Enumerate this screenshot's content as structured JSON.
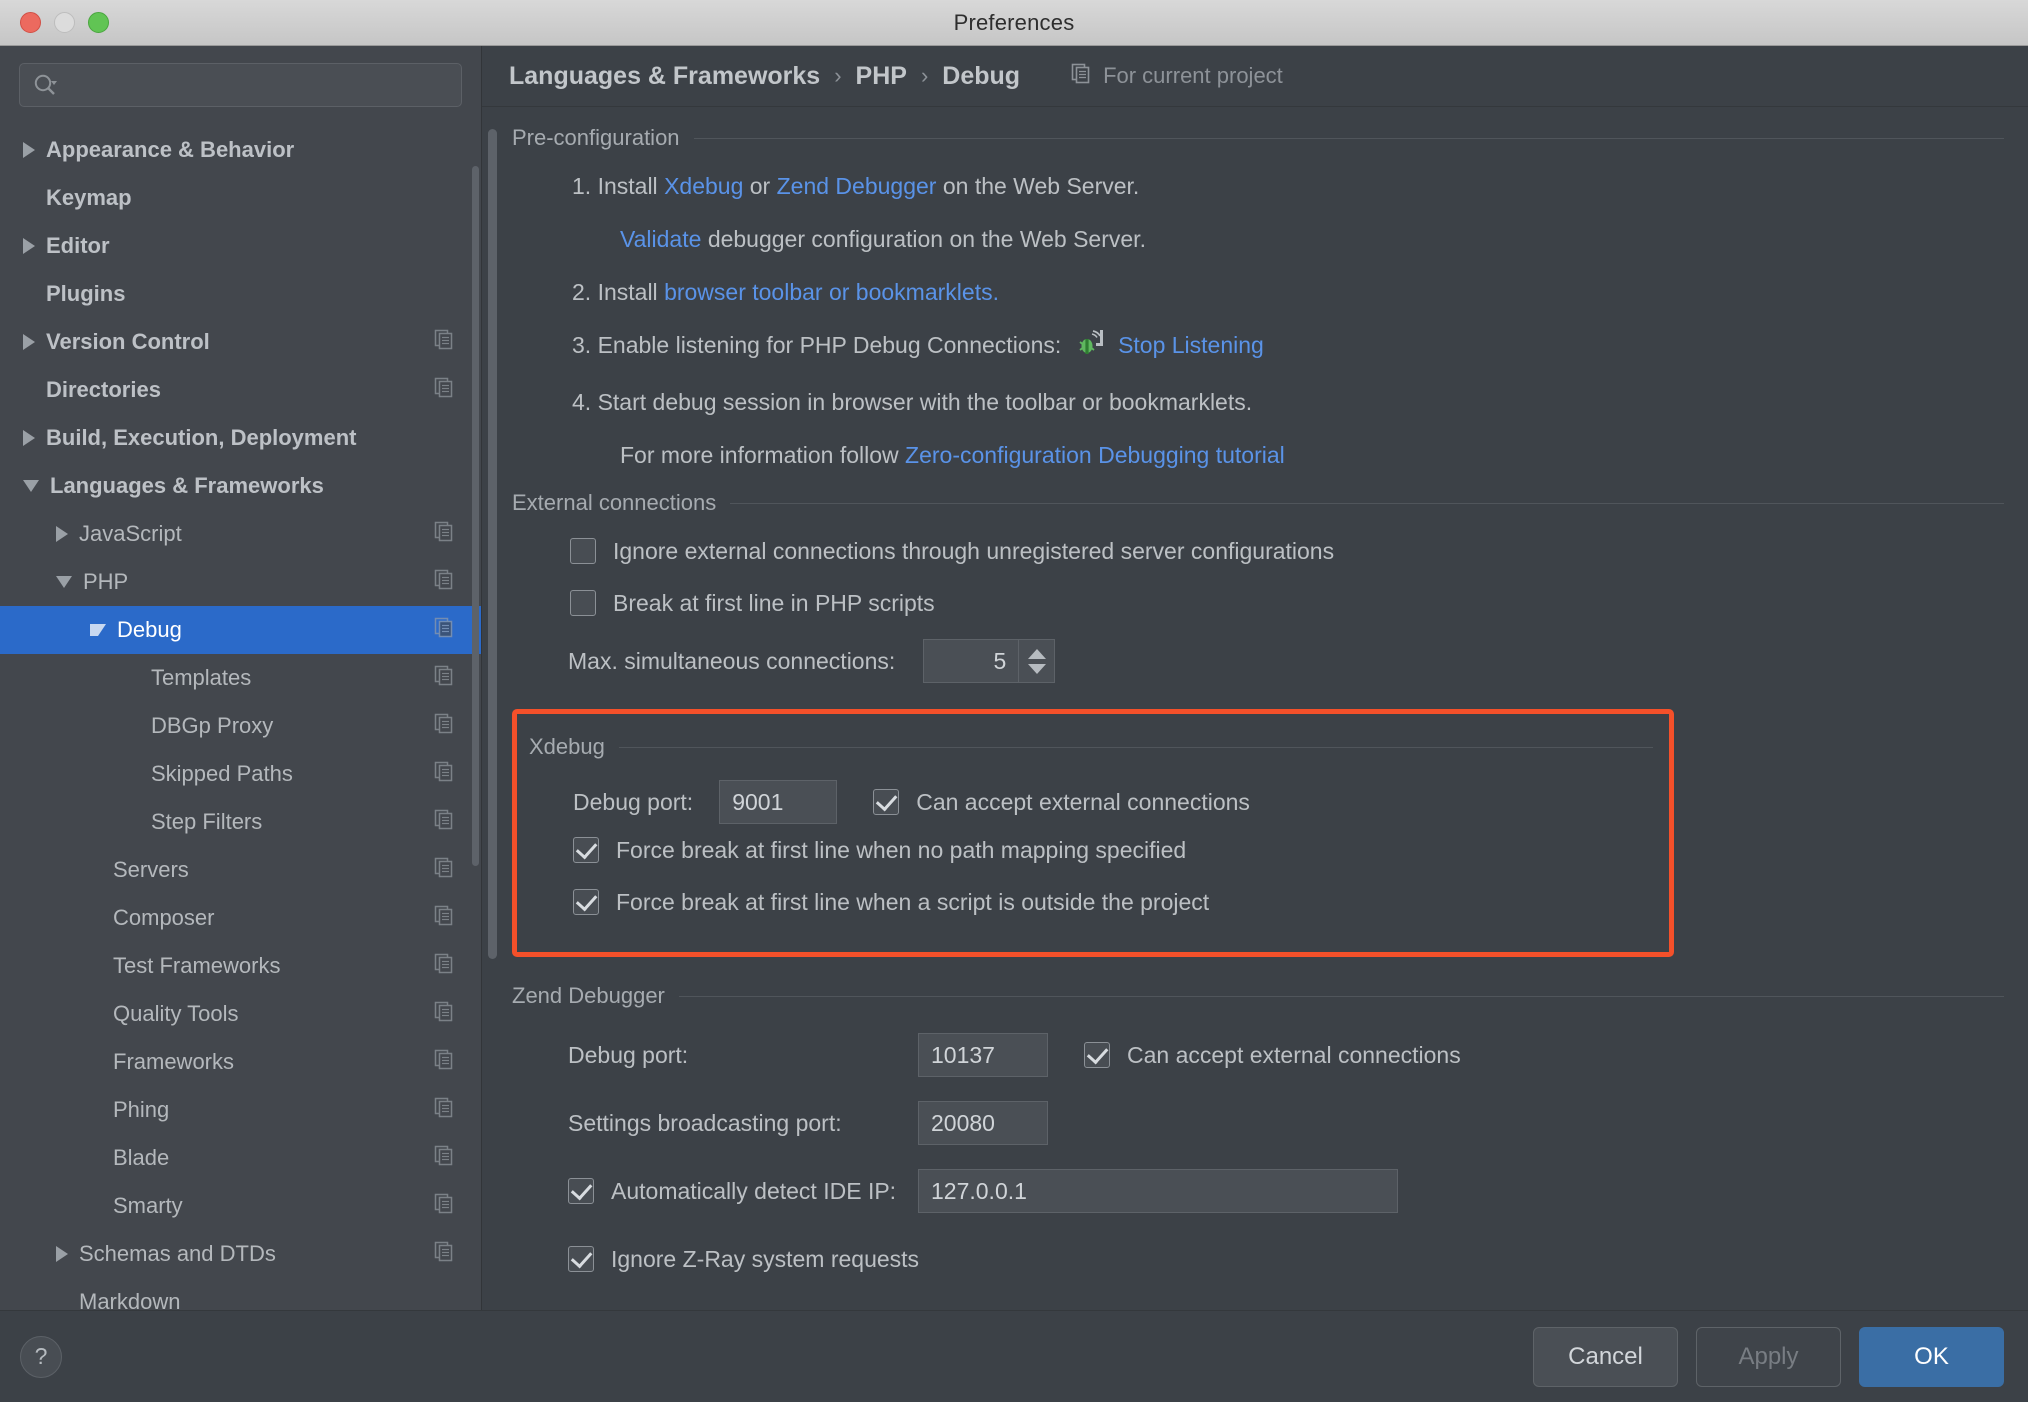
{
  "window": {
    "title": "Preferences",
    "traffic_lights": [
      "close-button",
      "minimize-button",
      "zoom-button"
    ]
  },
  "sidebar": {
    "search": {
      "placeholder": "",
      "value": "",
      "icon": "search-icon"
    },
    "items": [
      {
        "label": "Appearance & Behavior",
        "indent": 0,
        "arrow": "right",
        "bold": true,
        "badge": false,
        "selected": false
      },
      {
        "label": "Keymap",
        "indent": 0,
        "arrow": "none",
        "bold": true,
        "badge": false,
        "selected": false
      },
      {
        "label": "Editor",
        "indent": 0,
        "arrow": "right",
        "bold": true,
        "badge": false,
        "selected": false
      },
      {
        "label": "Plugins",
        "indent": 0,
        "arrow": "none",
        "bold": true,
        "badge": false,
        "selected": false
      },
      {
        "label": "Version Control",
        "indent": 0,
        "arrow": "right",
        "bold": true,
        "badge": true,
        "selected": false
      },
      {
        "label": "Directories",
        "indent": 0,
        "arrow": "none",
        "bold": true,
        "badge": true,
        "selected": false
      },
      {
        "label": "Build, Execution, Deployment",
        "indent": 0,
        "arrow": "right",
        "bold": true,
        "badge": false,
        "selected": false
      },
      {
        "label": "Languages & Frameworks",
        "indent": 0,
        "arrow": "down",
        "bold": true,
        "badge": false,
        "selected": false
      },
      {
        "label": "JavaScript",
        "indent": 1,
        "arrow": "right",
        "bold": false,
        "badge": true,
        "selected": false
      },
      {
        "label": "PHP",
        "indent": 1,
        "arrow": "down",
        "bold": false,
        "badge": true,
        "selected": false
      },
      {
        "label": "Debug",
        "indent": 2,
        "arrow": "down",
        "bold": false,
        "badge": true,
        "selected": true
      },
      {
        "label": "Templates",
        "indent": 3,
        "arrow": "none",
        "bold": false,
        "badge": true,
        "selected": false
      },
      {
        "label": "DBGp Proxy",
        "indent": 3,
        "arrow": "none",
        "bold": false,
        "badge": true,
        "selected": false
      },
      {
        "label": "Skipped Paths",
        "indent": 3,
        "arrow": "none",
        "bold": false,
        "badge": true,
        "selected": false
      },
      {
        "label": "Step Filters",
        "indent": 3,
        "arrow": "none",
        "bold": false,
        "badge": true,
        "selected": false
      },
      {
        "label": "Servers",
        "indent": 2,
        "arrow": "none",
        "bold": false,
        "badge": true,
        "selected": false
      },
      {
        "label": "Composer",
        "indent": 2,
        "arrow": "none",
        "bold": false,
        "badge": true,
        "selected": false
      },
      {
        "label": "Test Frameworks",
        "indent": 2,
        "arrow": "none",
        "bold": false,
        "badge": true,
        "selected": false
      },
      {
        "label": "Quality Tools",
        "indent": 2,
        "arrow": "none",
        "bold": false,
        "badge": true,
        "selected": false
      },
      {
        "label": "Frameworks",
        "indent": 2,
        "arrow": "none",
        "bold": false,
        "badge": true,
        "selected": false
      },
      {
        "label": "Phing",
        "indent": 2,
        "arrow": "none",
        "bold": false,
        "badge": true,
        "selected": false
      },
      {
        "label": "Blade",
        "indent": 2,
        "arrow": "none",
        "bold": false,
        "badge": true,
        "selected": false
      },
      {
        "label": "Smarty",
        "indent": 2,
        "arrow": "none",
        "bold": false,
        "badge": true,
        "selected": false
      },
      {
        "label": "Schemas and DTDs",
        "indent": 1,
        "arrow": "right",
        "bold": false,
        "badge": true,
        "selected": false
      },
      {
        "label": "Markdown",
        "indent": 1,
        "arrow": "none",
        "bold": false,
        "badge": false,
        "selected": false
      }
    ]
  },
  "breadcrumb": {
    "crumb1": "Languages & Frameworks",
    "crumb2": "PHP",
    "crumb3": "Debug",
    "separator": "›",
    "scope_label": "For current project",
    "scope_icon": "copy-project-icon"
  },
  "preconfiguration": {
    "title": "Pre-configuration",
    "step1_num": "1.",
    "step1_a": "Install",
    "step1_link1": "Xdebug",
    "step1_b": "or",
    "step1_link2": "Zend Debugger",
    "step1_c": "on the Web Server.",
    "step1_sub_link": "Validate",
    "step1_sub_text": "debugger configuration on the Web Server.",
    "step2_num": "2.",
    "step2_a": "Install",
    "step2_link": "browser toolbar or bookmarklets.",
    "step3_num": "3.",
    "step3_a": "Enable listening for PHP Debug Connections:",
    "step3_action": "Stop Listening",
    "step3_icon": "listening-bug-icon",
    "step4_num": "4.",
    "step4_a": "Start debug session in browser with the toolbar or bookmarklets.",
    "step4_sub_text": "For more information follow",
    "step4_sub_link": "Zero-configuration Debugging tutorial"
  },
  "external_connections": {
    "title": "External connections",
    "ignore_external_label": "Ignore external connections through unregistered server configurations",
    "ignore_external_checked": false,
    "break_first_line_label": "Break at first line in PHP scripts",
    "break_first_line_checked": false,
    "max_connections_label": "Max. simultaneous connections:",
    "max_connections_value": "5"
  },
  "xdebug": {
    "title": "Xdebug",
    "highlight_color": "#f4502a",
    "debug_port_label": "Debug port:",
    "debug_port_value": "9001",
    "can_accept_label": "Can accept external connections",
    "can_accept_checked": true,
    "force_break_no_mapping_label": "Force break at first line when no path mapping specified",
    "force_break_no_mapping_checked": true,
    "force_break_outside_label": "Force break at first line when a script is outside the project",
    "force_break_outside_checked": true
  },
  "zend_debugger": {
    "title": "Zend Debugger",
    "debug_port_label": "Debug port:",
    "debug_port_value": "10137",
    "can_accept_label": "Can accept external connections",
    "can_accept_checked": true,
    "broadcast_port_label": "Settings broadcasting port:",
    "broadcast_port_value": "20080",
    "auto_detect_label": "Automatically detect IDE IP:",
    "auto_detect_checked": true,
    "ide_ip_value": "127.0.0.1",
    "ignore_zray_label": "Ignore Z-Ray system requests",
    "ignore_zray_checked": true
  },
  "footer": {
    "help_label": "?",
    "cancel_label": "Cancel",
    "apply_label": "Apply",
    "apply_disabled": true,
    "ok_label": "OK",
    "ok_color": "#3a6ea5"
  }
}
